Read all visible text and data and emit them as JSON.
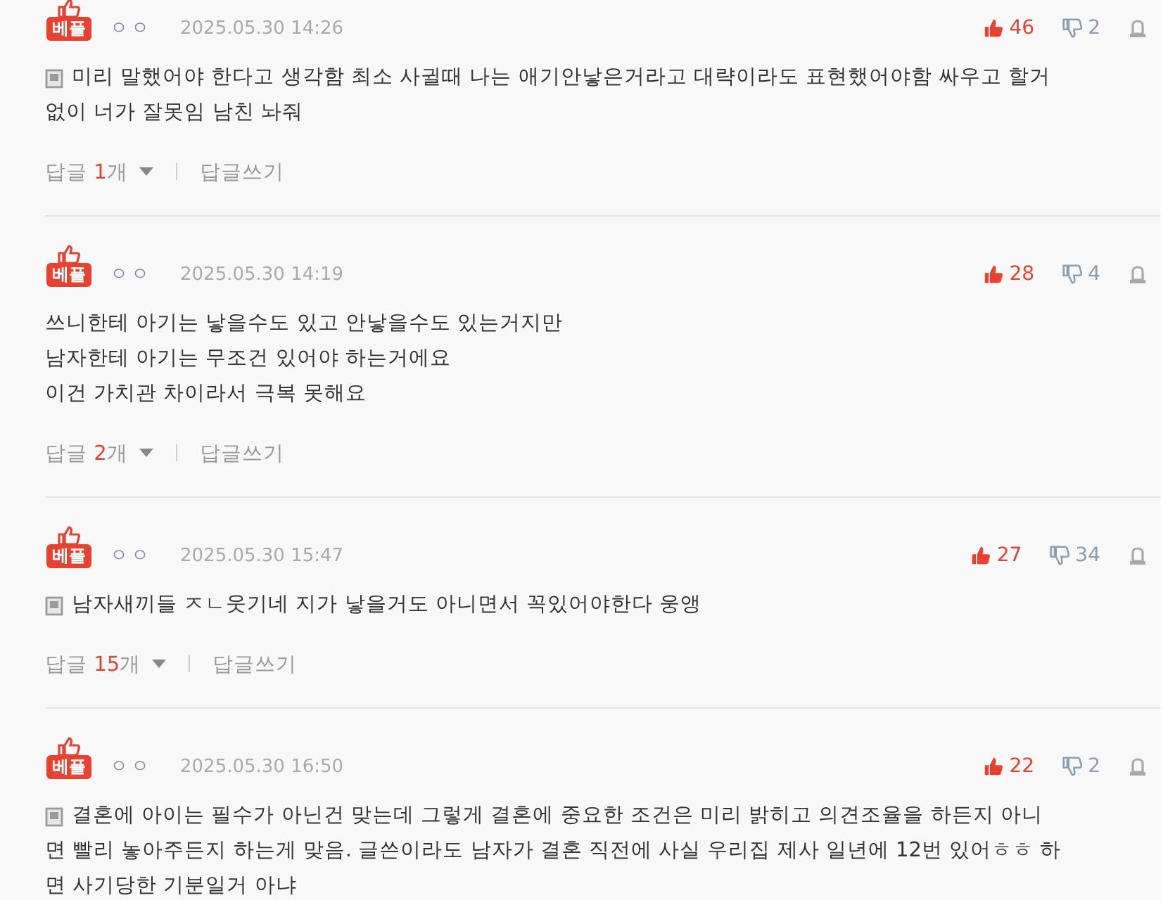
{
  "comments": [
    {
      "badge": "베플",
      "author": "ㅇㅇ",
      "time": "2025.05.30 14:26",
      "attachment": true,
      "lines": [
        "미리 말했어야 한다고 생각함 최소 사귈때 나는 애기안낳은거라고 대략이라도 표현했어야함 싸우고 할거",
        "없이 너가 잘못임 남친 놔줘"
      ],
      "likes": "46",
      "dislikes": "2",
      "reply_label": "답글",
      "reply_count": "1",
      "reply_unit": "개",
      "write_reply": "답글쓰기"
    },
    {
      "badge": "베플",
      "author": "ㅇㅇ",
      "time": "2025.05.30 14:19",
      "attachment": false,
      "lines": [
        "쓰니한테 아기는 낳을수도 있고 안낳을수도 있는거지만",
        "남자한테 아기는 무조건 있어야 하는거에요",
        "이건 가치관 차이라서 극복 못해요"
      ],
      "likes": "28",
      "dislikes": "4",
      "reply_label": "답글",
      "reply_count": "2",
      "reply_unit": "개",
      "write_reply": "답글쓰기"
    },
    {
      "badge": "베플",
      "author": "ㅇㅇ",
      "time": "2025.05.30 15:47",
      "attachment": true,
      "lines": [
        "남자새끼들 ㅈㄴ웃기네 지가 낳을거도 아니면서 꼭있어야한다 웅앵"
      ],
      "likes": "27",
      "dislikes": "34",
      "reply_label": "답글",
      "reply_count": "15",
      "reply_unit": "개",
      "write_reply": "답글쓰기"
    },
    {
      "badge": "베플",
      "author": "ㅇㅇ",
      "time": "2025.05.30 16:50",
      "attachment": true,
      "lines": [
        "결혼에 아이는 필수가 아닌건 맞는데 그렇게 결혼에 중요한 조건은 미리 밝히고 의견조율을 하든지 아니",
        "면 빨리 놓아주든지 하는게 맞음. 글쓴이라도 남자가 결혼 직전에 사실 우리집 제사 일년에 12번 있어ㅎㅎ 하",
        "면 사기당한 기분일거 아냐"
      ],
      "likes": "22",
      "dislikes": "2"
    }
  ]
}
